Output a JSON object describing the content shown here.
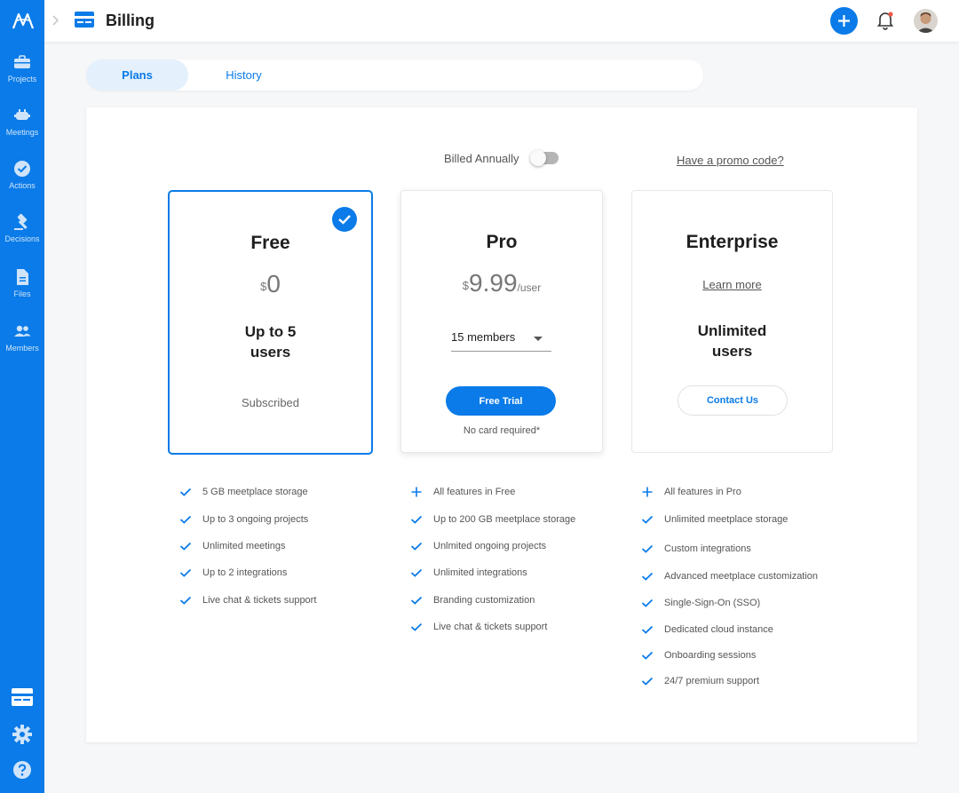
{
  "header": {
    "title": "Billing"
  },
  "sidebar": {
    "items": [
      {
        "label": "Projects"
      },
      {
        "label": "Meetings"
      },
      {
        "label": "Actions"
      },
      {
        "label": "Decisions"
      },
      {
        "label": "Files"
      },
      {
        "label": "Members"
      }
    ]
  },
  "tabs": [
    {
      "label": "Plans"
    },
    {
      "label": "History"
    }
  ],
  "billing": {
    "billed_label": "Billed Annually",
    "promo_label": "Have a promo code?"
  },
  "plans": {
    "free": {
      "name": "Free",
      "currency": "$",
      "price": "0",
      "users_line1": "Up to 5",
      "users_line2": "users",
      "status": "Subscribed"
    },
    "pro": {
      "name": "Pro",
      "currency": "$",
      "price": "9.99",
      "per": "/user",
      "members": "15 members",
      "cta": "Free Trial",
      "note": "No card required*"
    },
    "enterprise": {
      "name": "Enterprise",
      "learn_more": "Learn more",
      "users_line1": "Unlimited",
      "users_line2": "users",
      "cta": "Contact Us"
    }
  },
  "features": {
    "free": [
      "5 GB meetplace storage",
      "Up to 3 ongoing projects",
      "Unlimited meetings",
      "Up to 2 integrations",
      "Live chat & tickets support"
    ],
    "pro": [
      "All features in Free",
      "Up to 200 GB meetplace storage",
      "Unlmited ongoing projects",
      "Unlimited integrations",
      "Branding customization",
      "Live chat & tickets support"
    ],
    "enterprise": [
      "All features in Pro",
      "Unlimited meetplace storage",
      "Custom integrations",
      "Advanced meetplace customization",
      "Single-Sign-On (SSO)",
      "Dedicated cloud instance",
      "Onboarding sessions",
      "24/7 premium support"
    ]
  },
  "colors": {
    "accent": "#0a7be8",
    "sidebar": "#0a7be8",
    "notification_dot": "#f05a4a"
  }
}
